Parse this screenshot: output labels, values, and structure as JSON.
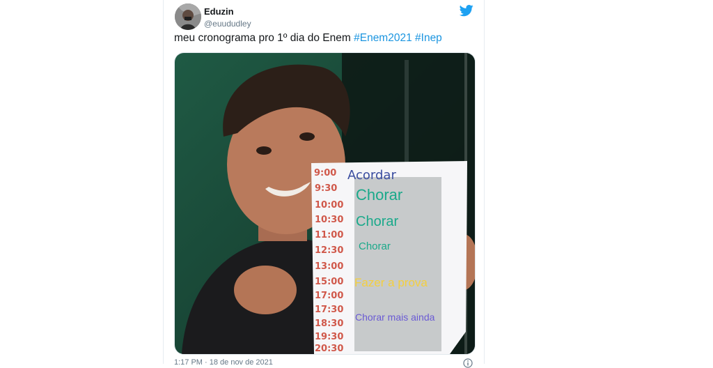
{
  "tweet": {
    "author_name": "Eduzin",
    "author_handle": "@euududley",
    "text_plain": "meu cronograma pro 1º dia do Enem ",
    "hashtags": [
      "#Enem2021",
      "#Inep"
    ],
    "timestamp": "1:17 PM · 18 de nov de 2021"
  },
  "schedule": {
    "times": [
      "9:00",
      "9:30",
      "10:00",
      "10:30",
      "11:00",
      "12:30",
      "13:00",
      "15:00",
      "17:00",
      "17:30",
      "18:30",
      "19:30",
      "20:30"
    ],
    "handwritten_task": "Acordar",
    "tasks": [
      "Chorar",
      "Chorar",
      "Chorar",
      "Fazer a prova",
      "Chorar mais ainda"
    ]
  },
  "colors": {
    "hashtag": "#1b95e0",
    "twitter_blue": "#1da1f2",
    "task_green": "#1aa98a",
    "task_yellow": "#f4cf3e",
    "task_purple": "#6a5ad4",
    "time_red": "#d0584a",
    "handwritten_blue": "#3a4da0"
  },
  "icons": [
    "twitter-bird-icon",
    "info-icon"
  ]
}
